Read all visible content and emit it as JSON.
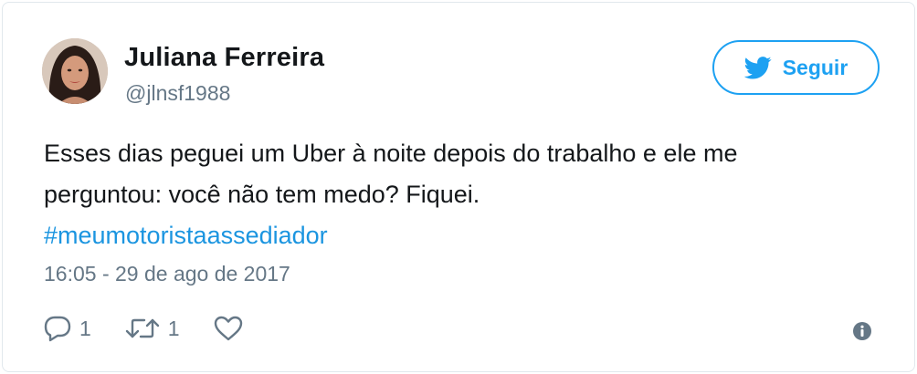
{
  "tweet": {
    "author": {
      "name": "Juliana Ferreira",
      "handle": "@jlnsf1988"
    },
    "follow_button": {
      "label": "Seguir",
      "icon": "twitter-bird-icon"
    },
    "text": {
      "line1": "Esses dias peguei um Uber à noite depois do trabalho e ele me",
      "line2": "perguntou: você não tem medo? Fiquei.",
      "hashtag": "#meumotoristaassediador"
    },
    "timestamp": "16:05 - 29 de ago de 2017",
    "actions": {
      "reply_count": "1",
      "retweet_count": "1",
      "reply_icon": "reply-bubble-icon",
      "retweet_icon": "retweet-icon",
      "like_icon": "heart-icon",
      "info_icon": "info-icon"
    },
    "colors": {
      "accent": "#1da1f2",
      "hashtag": "#1b95e0",
      "text": "#14171a",
      "secondary": "#657786",
      "border": "#e1e8ed"
    }
  }
}
